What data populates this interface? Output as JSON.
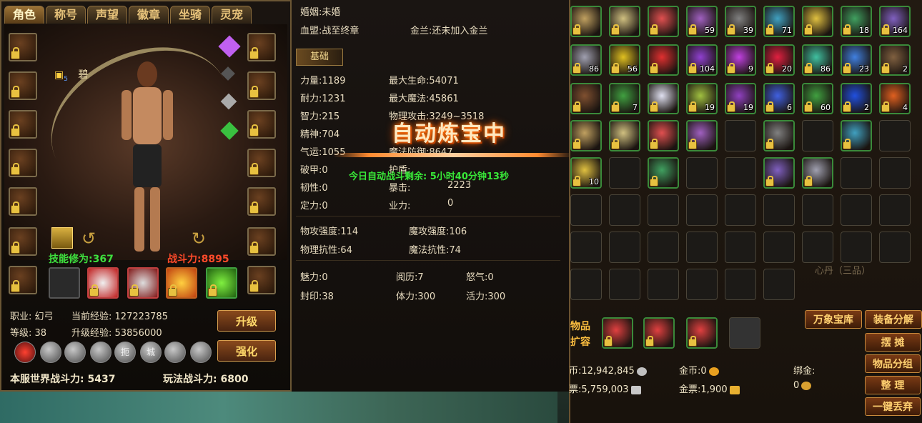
{
  "tabs": [
    "角色",
    "称号",
    "声望",
    "徽章",
    "坐骑",
    "灵宠"
  ],
  "character": {
    "name_glyph": "碧",
    "level_badge": "5",
    "skill_cultivation": "技能修为:367",
    "battle_power": "战斗力:8895",
    "class_label": "职业:",
    "class_value": "幻弓",
    "current_exp_label": "当前经验:",
    "current_exp_value": "127223785",
    "level_label": "等级:",
    "level_value": "38",
    "upgrade_exp_label": "升级经验:",
    "upgrade_exp_value": "53856000",
    "upgrade_button": "升级",
    "enhance_button": "强化",
    "badge_texts": [
      "扼",
      "城"
    ],
    "server_power_label": "本服世界战斗力:",
    "server_power_value": "5437",
    "play_power_label": "玩法战斗力:",
    "play_power_value": "6800"
  },
  "social": {
    "marriage_label": "婚姻:",
    "marriage_value": "未婚",
    "blood_alliance_label": "血盟:",
    "blood_alliance_value": "战至终章",
    "golden_orchid_label": "金兰:",
    "golden_orchid_value": "还未加入金兰"
  },
  "section_basic": "基础",
  "stats": {
    "strength": "力量:1189",
    "max_hp": "最大生命:54071",
    "endurance": "耐力:1231",
    "max_mp": "最大魔法:45861",
    "intelligence": "智力:215",
    "phys_attack": "物理攻击:3249~3518",
    "spirit": "精神:704",
    "luck": "气运:1055",
    "magic_defense": "魔法防御:8647",
    "armor_break": "破甲:0",
    "protection": "护盾:",
    "toughness": "韧性:0",
    "crit": "暴击:",
    "crit_value": "2223",
    "focus": "定力:0",
    "karma": "业力:",
    "karma_value": "0",
    "phys_strength": "物攻强度:114",
    "magic_strength": "魔攻强度:106",
    "phys_resist": "物理抗性:64",
    "magic_resist": "魔法抗性:74",
    "charm": "魅力:0",
    "experience": "阅历:7",
    "rage": "怒气:0",
    "seal": "封印:38",
    "stamina": "体力:300",
    "vitality": "活力:300"
  },
  "auto_refine": {
    "title": "自动炼宝中",
    "remaining": "今日自动战斗剩余: 5小时40分钟13秒"
  },
  "inventory": {
    "counts": [
      "59",
      "39",
      "71",
      "18",
      "164",
      "86",
      "56",
      "104",
      "9",
      "20",
      "86",
      "23",
      "2",
      "7",
      "19",
      "19",
      "6",
      "60",
      "2",
      "4",
      "10"
    ],
    "expand_label_1": "物品",
    "expand_label_2": "扩容",
    "buttons": {
      "treasure": "万象宝库",
      "disassemble": "装备分解",
      "stall": "摆 摊",
      "group": "物品分组",
      "tidy": "整 理",
      "discard": "一键丢弃"
    },
    "money": {
      "coins": "币:12,942,845",
      "gold_coin": "金币:0",
      "bound_gold_label": "绑金:",
      "tickets": "票:5,759,003",
      "gold_ticket": "金票:1,900",
      "bound_gold_value": "0"
    },
    "bg_text": "心丹（三品）"
  },
  "colors": {
    "skill_green": "#3ee03e",
    "power_red": "#ff4a2a",
    "gold": "#ffd070"
  }
}
